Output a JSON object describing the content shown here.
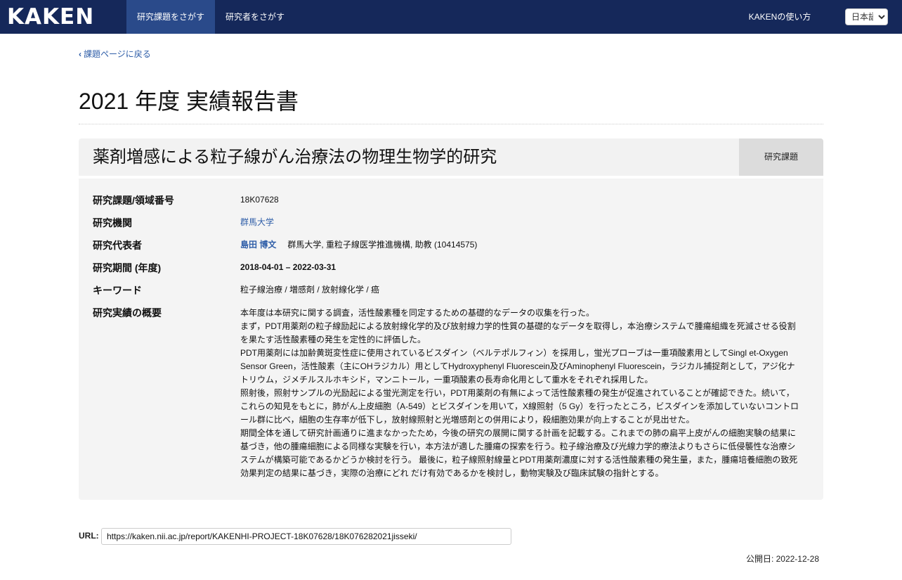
{
  "nav": {
    "logo": "KAKEN",
    "projects": "研究課題をさがす",
    "researchers": "研究者をさがす",
    "help": "KAKENの使い方",
    "language": "日本語"
  },
  "back_link": "課題ページに戻る",
  "page_title": "2021 年度 実績報告書",
  "project": {
    "title": "薬剤増感による粒子線がん治療法の物理生物学的研究",
    "type": "研究課題",
    "fields": {
      "number_label": "研究課題/領域番号",
      "number": "18K07628",
      "institution_label": "研究機関",
      "institution": "群馬大学",
      "pi_label": "研究代表者",
      "pi_name": "島田 博文",
      "pi_affiliation": "群馬大学, 重粒子線医学推進機構, 助教 (10414575)",
      "period_label": "研究期間 (年度)",
      "period": "2018-04-01 – 2022-03-31",
      "keywords_label": "キーワード",
      "keywords": "粒子線治療 / 増感剤 / 放射線化学 / 癌",
      "summary_label": "研究実績の概要",
      "summary": [
        "本年度は本研究に関する調査，活性酸素種を同定するための基礎的なデータの収集を行った。",
        "まず，PDT用薬剤の粒子線励起による放射線化学的及び放射線力学的性質の基礎的なデータを取得し，本治療システムで腫瘍組織を死滅させる役割を果たす活性酸素種の発生を定性的に評価した。",
        "PDT用薬剤には加齢黄斑変性症に使用されているビスダイン（ベルテポルフィン）を採用し，蛍光プローブは一重項酸素用としてSingl et-Oxygen Sensor Green，活性酸素（主にOHラジカル）用としてHydroxyphenyl Fluorescein及びAminophenyl Fluorescein，ラジカル捕捉剤として，アジ化ナトリウム，ジメチルスルホキシド，マンニトール，一重項酸素の長寿命化用として重水をそれぞれ採用した。",
        "照射後，照射サンプルの光励起による蛍光測定を行い，PDT用薬剤の有無によって活性酸素種の発生が促進されていることが確認できた。続いて，これらの知見をもとに，肺がん上皮細胞（A-549）とビスダインを用いて，X線照射（5 Gy）を行ったところ，ビスダインを添加していないコントロール群に比べ，細胞の生存率が低下し，放射線照射と光増感剤との併用により，殺細胞効果が向上することが見出せた。",
        "期間全体を通して研究計画通りに進まなかったため，今後の研究の展開に関する計画を記載する。これまでの肺の扁平上皮がんの細胞実験の結果に基づき，他の腫瘍細胞による同様な実験を行い，本方法が適した腫瘍の探索を行う。粒子線治療及び光線力学的療法よりもさらに低侵襲性な治療システムが構築可能であるかどうか検討を行う。 最後に，粒子線照射線量とPDT用薬剤濃度に対する活性酸素種の発生量，また，腫瘍培養細胞の致死効果判定の結果に基づき，実際の治療にどれ だけ有効であるかを検討し，動物実験及び臨床試験の指針とする。"
      ]
    }
  },
  "url": {
    "label": "URL:",
    "value": "https://kaken.nii.ac.jp/report/KAKENHI-PROJECT-18K07628/18K076282021jisseki/"
  },
  "published": "公開日: 2022-12-28"
}
